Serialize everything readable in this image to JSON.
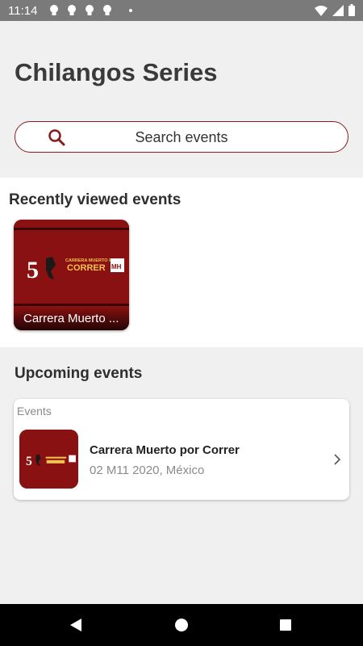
{
  "status_bar": {
    "time": "11:14",
    "notification_icons": [
      "lightbulb-icon",
      "lightbulb-icon",
      "lightbulb-icon",
      "lightbulb-icon"
    ],
    "system_icons": [
      "wifi-icon",
      "signal-icon",
      "battery-icon"
    ]
  },
  "header": {
    "title": "Chilangos Series"
  },
  "search": {
    "placeholder": "Search events",
    "icon": "search-icon"
  },
  "recent": {
    "title": "Recently viewed events",
    "items": [
      {
        "caption": "Carrera Muerto ..."
      }
    ]
  },
  "upcoming": {
    "title": "Upcoming events",
    "group_label": "Events",
    "items": [
      {
        "title": "Carrera Muerto por Correr",
        "date": "02 M11 2020, México"
      }
    ]
  },
  "banner": {
    "number": "5",
    "line1": "CARRERA MUERTO POR",
    "line2": "CORRER",
    "badge": "MH"
  },
  "nav": {
    "icons": [
      "back-icon",
      "home-icon",
      "recents-icon"
    ]
  },
  "colors": {
    "accent": "#8b1a1a",
    "banner_bg": "#8a1111",
    "banner_text": "#f2c14e"
  }
}
